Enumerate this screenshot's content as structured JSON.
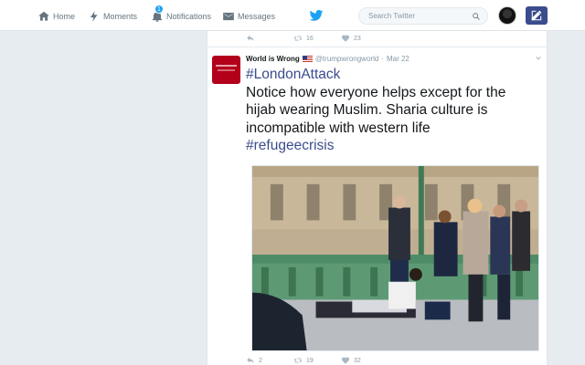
{
  "nav": {
    "home": "Home",
    "moments": "Moments",
    "notifications": "Notifications",
    "notifications_badge": "1",
    "messages": "Messages"
  },
  "search": {
    "placeholder": "Search Twitter"
  },
  "prev_tweet": {
    "retweets": "16",
    "likes": "23"
  },
  "tweet": {
    "name": "World is Wrong",
    "handle": "@trumpwrongworld",
    "separator": "·",
    "date": "Mar 22",
    "hashtag1": "#LondonAttack",
    "line1": "Notice how everyone helps except for the",
    "line2": "hijab wearing Muslim. Sharia culture is",
    "line3": "incompatible with western life",
    "hashtag2": "#refugeecrisis",
    "replies": "2",
    "retweets": "19",
    "likes": "32"
  },
  "colors": {
    "accent": "#1da1f2",
    "hashtag": "#3b4c8c",
    "avatar": "#b3001b"
  },
  "icons": [
    "home-icon",
    "moments-icon",
    "notifications-icon",
    "messages-icon",
    "twitter-bird-icon",
    "search-icon",
    "compose-icon",
    "reply-icon",
    "retweet-icon",
    "like-icon",
    "caret-down-icon",
    "us-flag-icon"
  ]
}
